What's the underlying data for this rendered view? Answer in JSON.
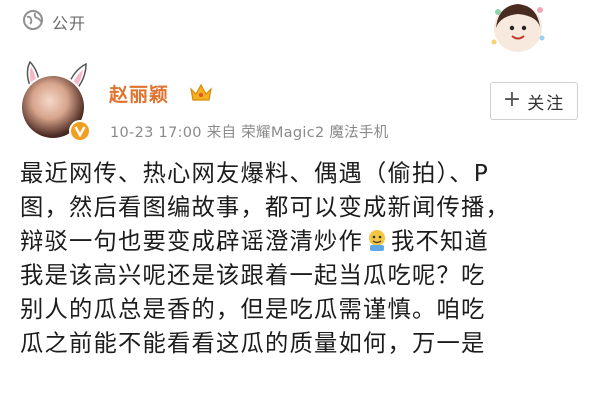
{
  "visibility": {
    "icon": "globe-icon",
    "label": "公开"
  },
  "header": {
    "username": "赵丽颖",
    "meta": "10-23 17:00  来自 荣耀Magic2 魔法手机",
    "follow_label": "关注",
    "follow_icon": "plus-icon"
  },
  "post": {
    "lines": [
      "最近网传、热心网友爆料、偶遇（偷拍）、P",
      "图，然后看图编故事，都可以变成新闻传播，",
      "辩驳一句也要变成辟谣澄清炒作",
      "我是该高兴呢还是该跟着一起当瓜吃呢？吃",
      "别人的瓜总是香的，但是吃瓜需谨慎。咱吃",
      "瓜之前能不能看看这瓜的质量如何，万一是"
    ],
    "line3_after_emoji": "我不知道",
    "emoji": "doge-emoji"
  },
  "colors": {
    "username": "#e0732f",
    "meta": "#8a8a8a",
    "badge": "#f0a020"
  }
}
